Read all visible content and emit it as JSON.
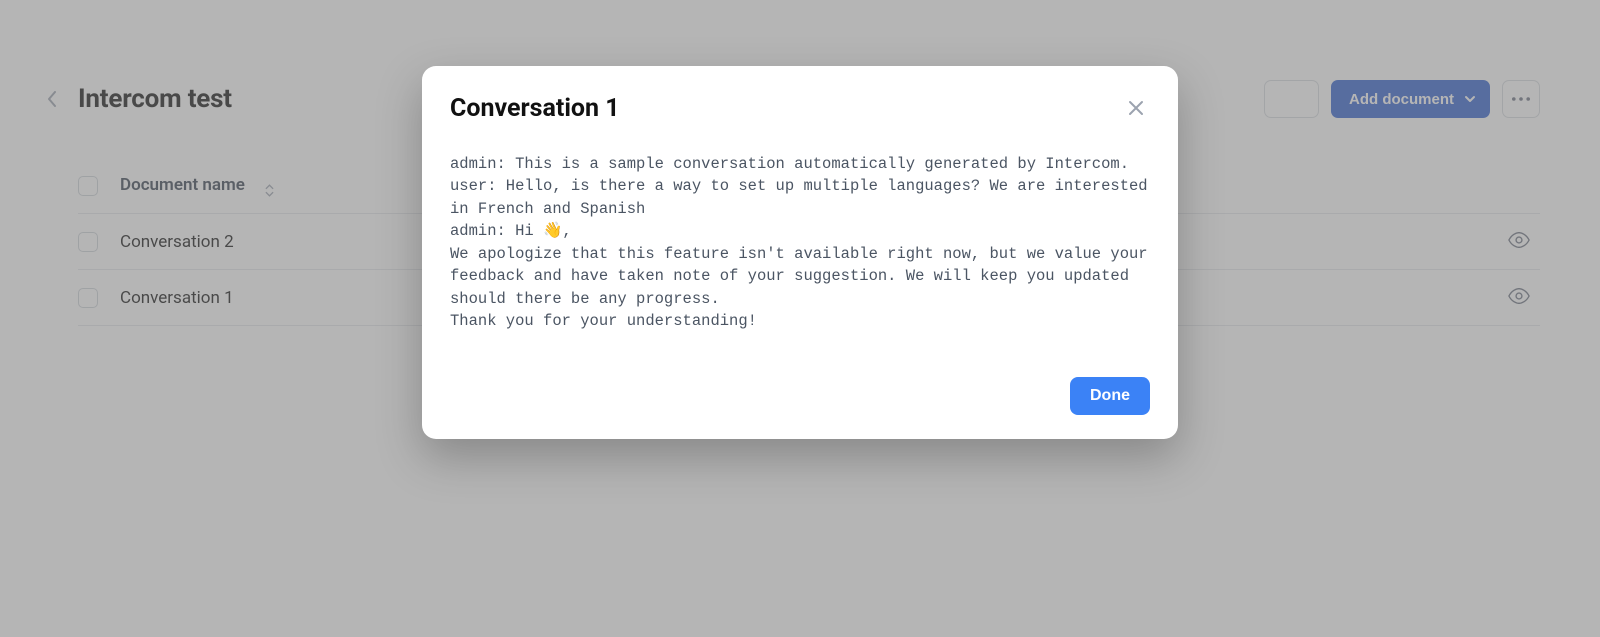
{
  "header": {
    "title": "Intercom test",
    "add_document_label": "Add document"
  },
  "table": {
    "column_name_header": "Document name",
    "rows": [
      {
        "name": "Conversation 2"
      },
      {
        "name": "Conversation 1"
      }
    ]
  },
  "modal": {
    "title": "Conversation 1",
    "body": "admin: This is a sample conversation automatically generated by Intercom.\nuser: Hello, is there a way to set up multiple languages? We are interested in French and Spanish\nadmin: Hi 👋,\nWe apologize that this feature isn't available right now, but we value your feedback and have taken note of your suggestion. We will keep you updated should there be any progress.\nThank you for your understanding!",
    "done_label": "Done"
  }
}
